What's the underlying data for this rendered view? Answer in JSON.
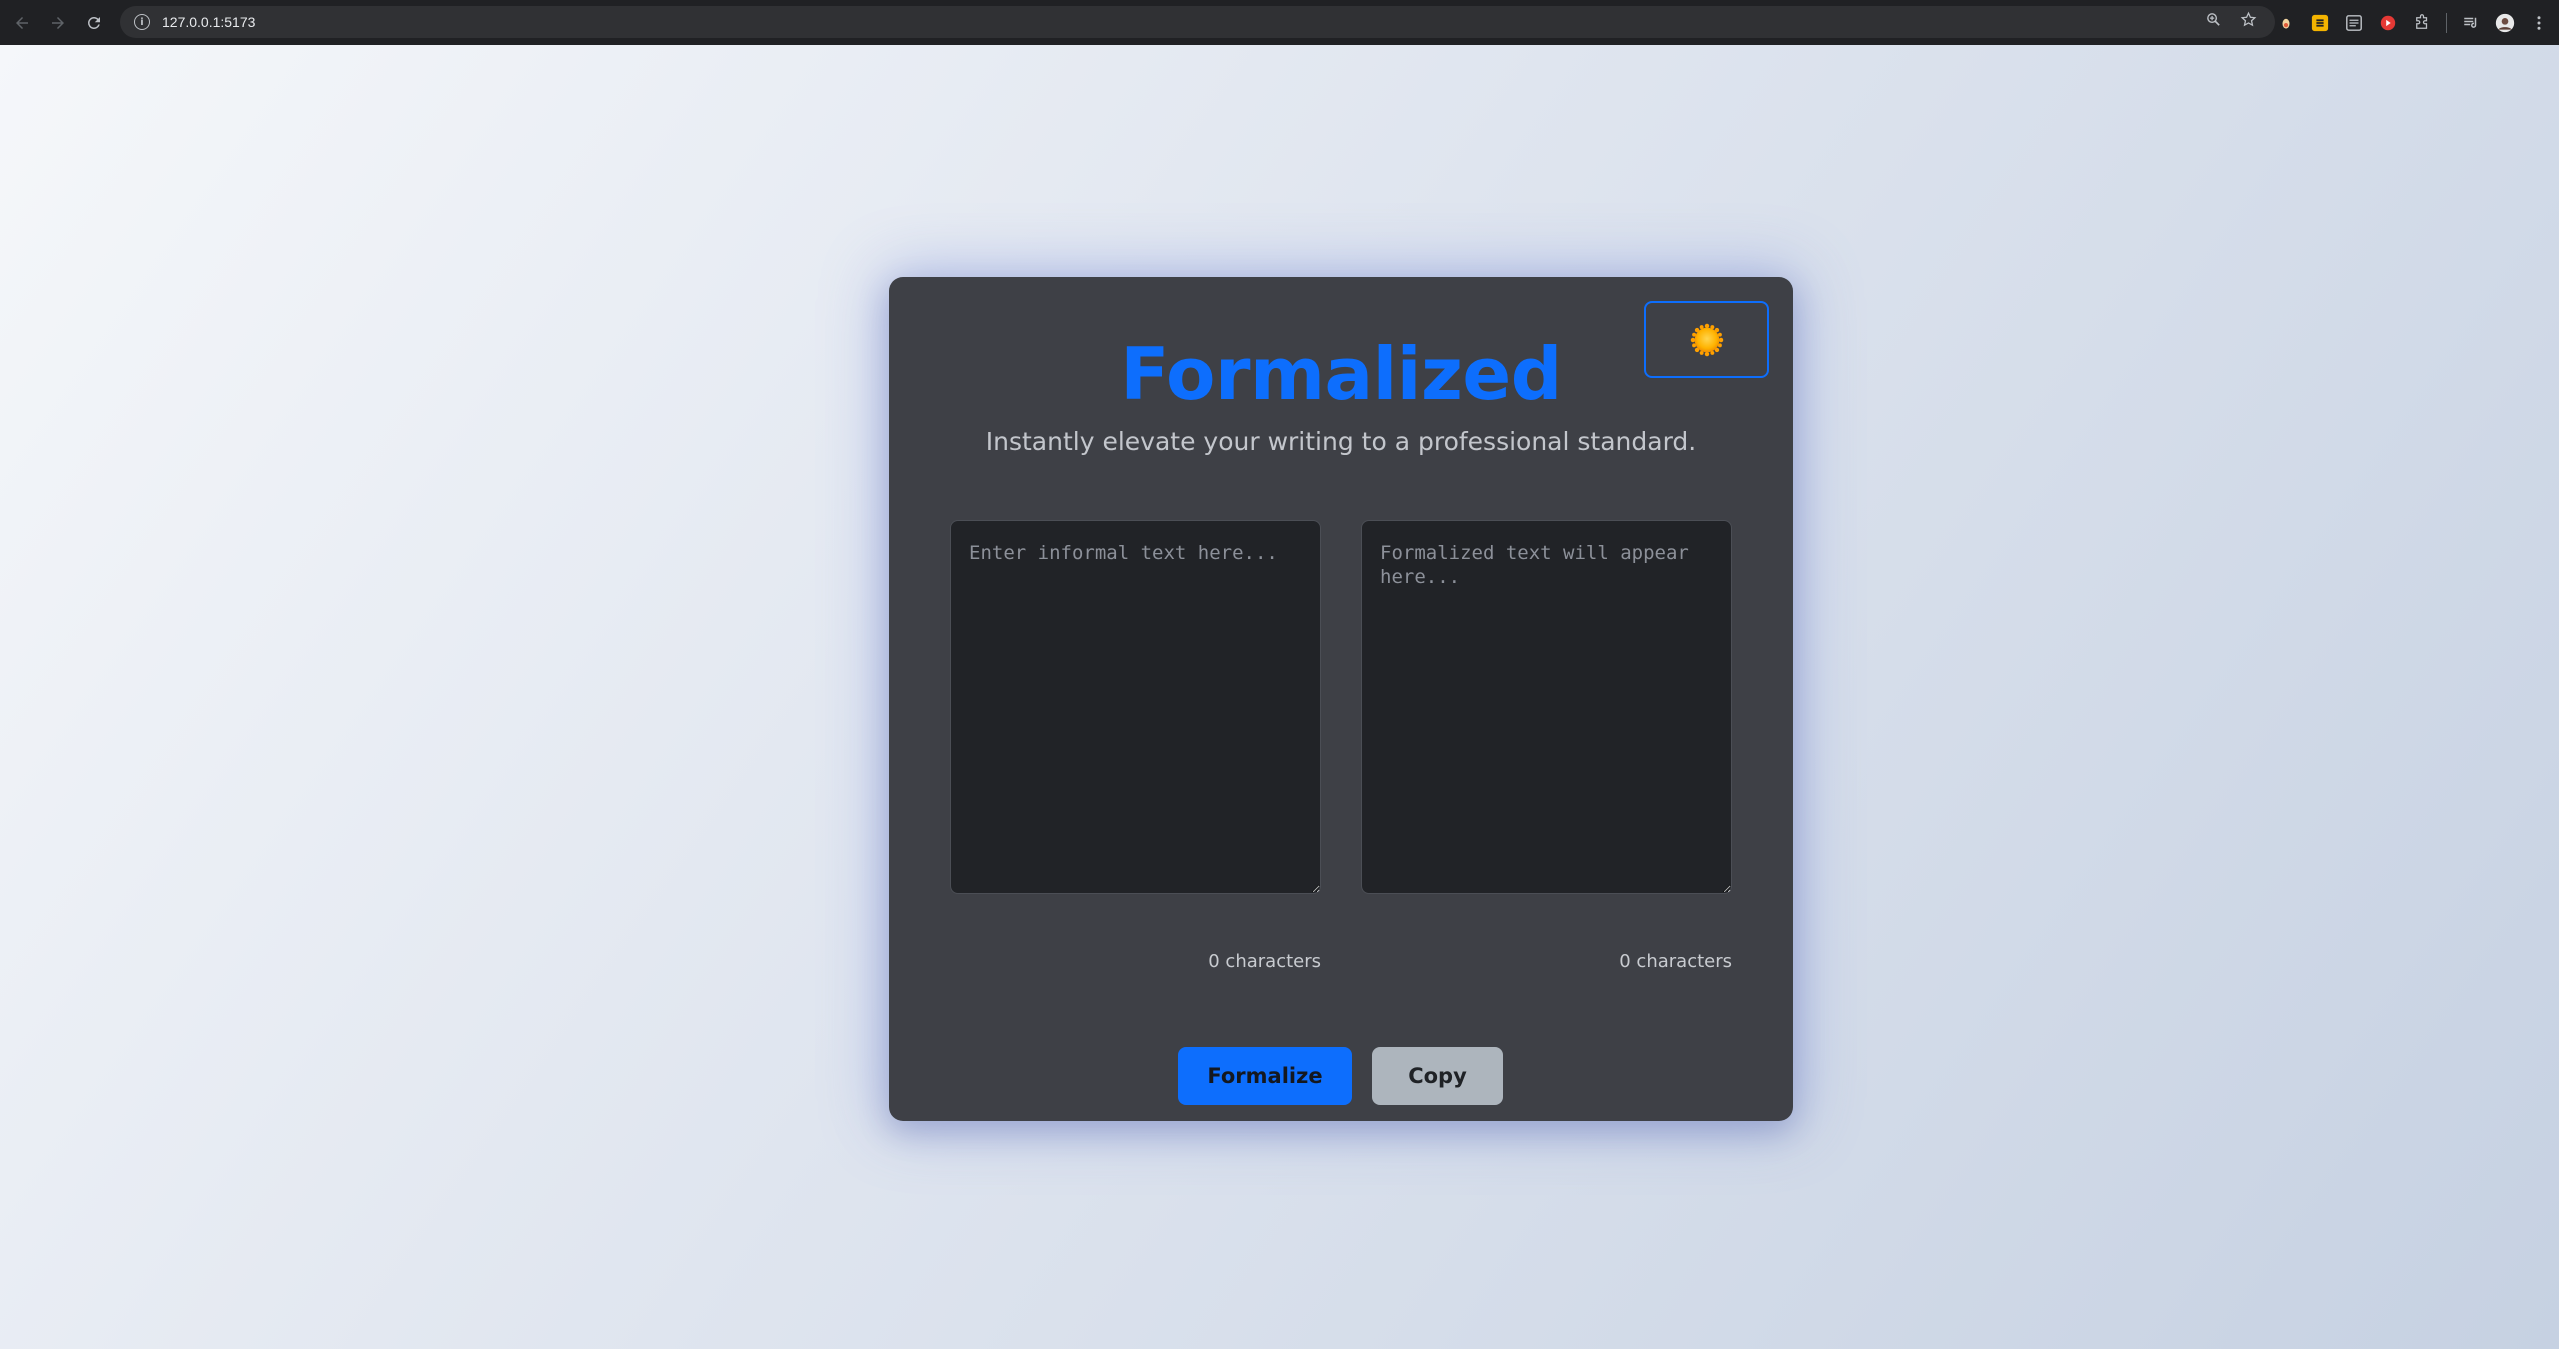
{
  "browser": {
    "url": "127.0.0.1:5173"
  },
  "app": {
    "title": "Formalized",
    "subtitle": "Instantly elevate your writing to a professional standard.",
    "theme_toggle_icon": "sun-icon",
    "input": {
      "placeholder": "Enter informal text here...",
      "value": "",
      "char_count": "0 characters"
    },
    "output": {
      "placeholder": "Formalized text will appear here...",
      "value": "",
      "char_count": "0 characters"
    },
    "buttons": {
      "formalize": "Formalize",
      "copy": "Copy"
    },
    "colors": {
      "accent": "#0d6efd",
      "card_bg": "#3e4046",
      "textarea_bg": "#212327",
      "copy_bg": "#adb5bd"
    }
  }
}
